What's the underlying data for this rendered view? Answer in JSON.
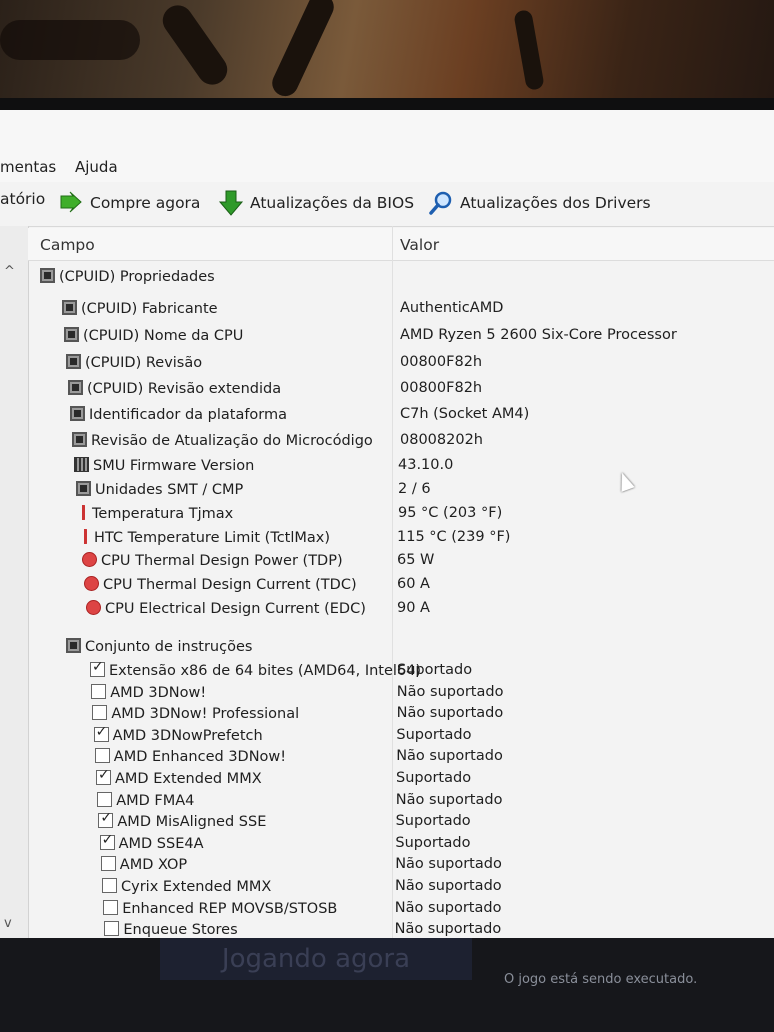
{
  "menu": {
    "items": [
      "mentas",
      "Ajuda"
    ]
  },
  "toolbar": {
    "items": [
      {
        "label": "atório",
        "icon": "report-icon"
      },
      {
        "label": "Compre agora",
        "icon": "buy-icon"
      },
      {
        "label": "Atualizações da BIOS",
        "icon": "down-arrow-icon"
      },
      {
        "label": "Atualizações dos Drivers",
        "icon": "search-icon"
      }
    ]
  },
  "columns": {
    "field": "Campo",
    "value": "Valor"
  },
  "groups": [
    {
      "title": "(CPUID) Propriedades",
      "rows": [
        {
          "field": "(CPUID) Fabricante",
          "value": "AuthenticAMD",
          "icon": "cpu"
        },
        {
          "field": "(CPUID) Nome da CPU",
          "value": "AMD Ryzen 5 2600 Six-Core Processor",
          "icon": "cpu"
        },
        {
          "field": "(CPUID) Revisão",
          "value": "00800F82h",
          "icon": "cpu"
        },
        {
          "field": "(CPUID) Revisão extendida",
          "value": "00800F82h",
          "icon": "cpu"
        },
        {
          "field": "Identificador da plataforma",
          "value": "C7h  (Socket AM4)",
          "icon": "cpu"
        },
        {
          "field": "Revisão de Atualização do Microcódigo",
          "value": "08008202h",
          "icon": "cpu"
        },
        {
          "field": "SMU Firmware Version",
          "value": "43.10.0",
          "icon": "smu"
        },
        {
          "field": "Unidades SMT / CMP",
          "value": "2 / 6",
          "icon": "cpu"
        },
        {
          "field": "Temperatura Tjmax",
          "value": "95 °C  (203 °F)",
          "icon": "thermo"
        },
        {
          "field": "HTC Temperature Limit (TctlMax)",
          "value": "115 °C  (239 °F)",
          "icon": "thermo"
        },
        {
          "field": "CPU Thermal Design Power (TDP)",
          "value": "65 W",
          "icon": "power"
        },
        {
          "field": "CPU Thermal Design Current (TDC)",
          "value": "60 A",
          "icon": "power"
        },
        {
          "field": "CPU Electrical Design Current (EDC)",
          "value": "90 A",
          "icon": "power"
        }
      ]
    },
    {
      "title": "Conjunto de instruções",
      "rows": [
        {
          "field": "Extensão x86 de 64 bites (AMD64, Intel64)",
          "value": "Suportado",
          "checked": true
        },
        {
          "field": "AMD 3DNow!",
          "value": "Não suportado",
          "checked": false
        },
        {
          "field": "AMD 3DNow! Professional",
          "value": "Não suportado",
          "checked": false
        },
        {
          "field": "AMD 3DNowPrefetch",
          "value": "Suportado",
          "checked": true
        },
        {
          "field": "AMD Enhanced 3DNow!",
          "value": "Não suportado",
          "checked": false
        },
        {
          "field": "AMD Extended MMX",
          "value": "Suportado",
          "checked": true
        },
        {
          "field": "AMD FMA4",
          "value": "Não suportado",
          "checked": false
        },
        {
          "field": "AMD MisAligned SSE",
          "value": "Suportado",
          "checked": true
        },
        {
          "field": "AMD SSE4A",
          "value": "Suportado",
          "checked": true
        },
        {
          "field": "AMD XOP",
          "value": "Não suportado",
          "checked": false
        },
        {
          "field": "Cyrix Extended MMX",
          "value": "Não suportado",
          "checked": false
        },
        {
          "field": "Enhanced REP MOVSB/STOSB",
          "value": "Não suportado",
          "checked": false
        },
        {
          "field": "Enqueue Stores",
          "value": "Não suportado",
          "checked": false
        }
      ]
    }
  ],
  "overlay": {
    "playing_label": "Jogando agora",
    "status_text": "O jogo está sendo executado."
  }
}
